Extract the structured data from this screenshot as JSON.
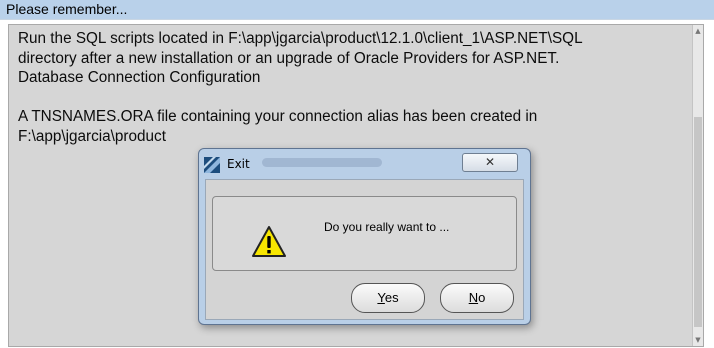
{
  "header": {
    "title": "Please remember..."
  },
  "message": {
    "lines": [
      "Run the SQL scripts located in F:\\app\\jgarcia\\product\\12.1.0\\client_1\\ASP.NET\\SQL",
      "directory after a new installation or an upgrade of Oracle Providers for ASP.NET.",
      "Database Connection Configuration",
      "",
      "A TNSNAMES.ORA file containing your connection alias has been created in",
      "F:\\app\\jgarcia\\product"
    ]
  },
  "dialog": {
    "title": "Exit",
    "message": "Do you really want to ...",
    "close_symbol": "✕",
    "yes_mnemonic": "Y",
    "yes_rest": "es",
    "no_mnemonic": "N",
    "no_rest": "o"
  },
  "icons": {
    "app": "oracle-installer-icon",
    "warning": "warning-icon",
    "close": "close-icon"
  },
  "colors": {
    "header_bg": "#b9d1ea",
    "panel_bg": "#d6d6d6",
    "dialog_frame": "#b9cfe7",
    "warning_yellow": "#f7e600"
  }
}
